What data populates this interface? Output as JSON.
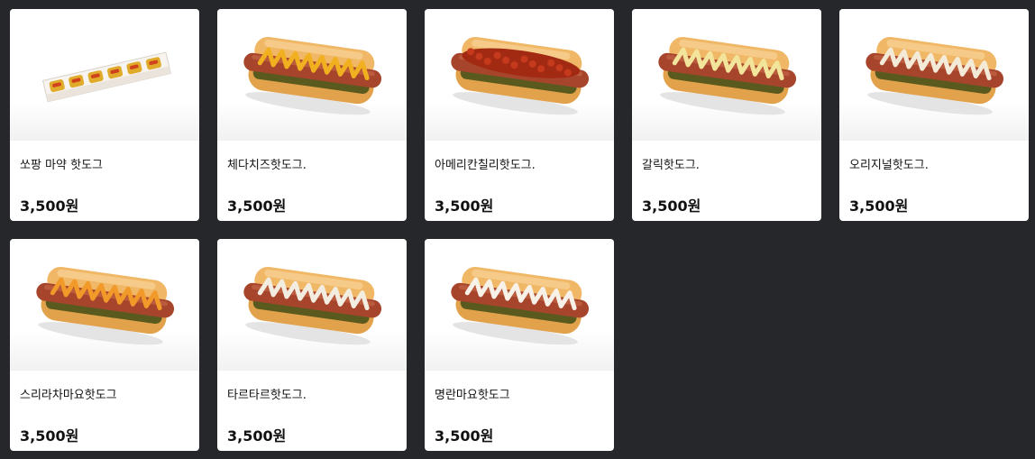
{
  "products": [
    {
      "name": "쏘팡 마약 핫도그",
      "price": "3,500원",
      "image_type": "box-pack",
      "sauce_color": "#e0aa2a",
      "sauce_secondary": "#d0421b"
    },
    {
      "name": "체다치즈핫도그.",
      "price": "3,500원",
      "image_type": "hotdog",
      "sauce_color": "#f0b020",
      "sauce_secondary": "#e6a41a"
    },
    {
      "name": "아메리칸칠리핫도그.",
      "price": "3,500원",
      "image_type": "hotdog-chili",
      "sauce_color": "#c5391c",
      "sauce_secondary": "#a32a12"
    },
    {
      "name": "갈릭핫도그.",
      "price": "3,500원",
      "image_type": "hotdog",
      "sauce_color": "#f2e49a",
      "sauce_secondary": "#e8d878"
    },
    {
      "name": "오리지널핫도그.",
      "price": "3,500원",
      "image_type": "hotdog",
      "sauce_color": "#f4ead8",
      "sauce_secondary": "#e7dcc4"
    },
    {
      "name": "스리라차마요핫도그",
      "price": "3,500원",
      "image_type": "hotdog",
      "sauce_color": "#f19a2a",
      "sauce_secondary": "#e88a1a"
    },
    {
      "name": "타르타르핫도그.",
      "price": "3,500원",
      "image_type": "hotdog",
      "sauce_color": "#f3ece0",
      "sauce_secondary": "#ded3c2"
    },
    {
      "name": "명란마요핫도그",
      "price": "3,500원",
      "image_type": "hotdog",
      "sauce_color": "#f7f1e8",
      "sauce_secondary": "#ece2d2"
    }
  ]
}
